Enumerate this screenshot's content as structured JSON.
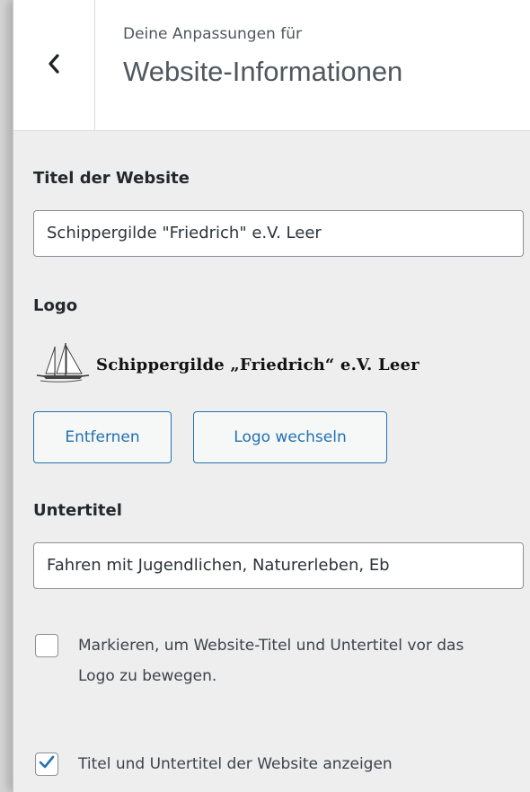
{
  "header": {
    "subtitle": "Deine Anpassungen für",
    "title": "Website-Informationen"
  },
  "site_title": {
    "label": "Titel der Website",
    "value": "Schippergilde \"Friedrich\" e.V. Leer"
  },
  "logo": {
    "label": "Logo",
    "image_text": "Schippergilde „Friedrich“ e.V. Leer",
    "remove_label": "Entfernen",
    "change_label": "Logo wechseln"
  },
  "tagline": {
    "label": "Untertitel",
    "value": "Fahren mit Jugendlichen, Naturerleben, Eb"
  },
  "options": {
    "title_before_logo": {
      "label": "Markieren, um Website-Titel und Untertitel vor das Logo zu bewegen.",
      "checked": false
    },
    "display_title_tagline": {
      "label": "Titel und Untertitel der Website anzeigen",
      "checked": true
    }
  },
  "colors": {
    "accent": "#2271b1",
    "panel_bg": "#eeeeee"
  },
  "icons": {
    "back": "chevron-left-icon",
    "check": "checkmark-icon",
    "logo": "sailing-ship-icon"
  }
}
